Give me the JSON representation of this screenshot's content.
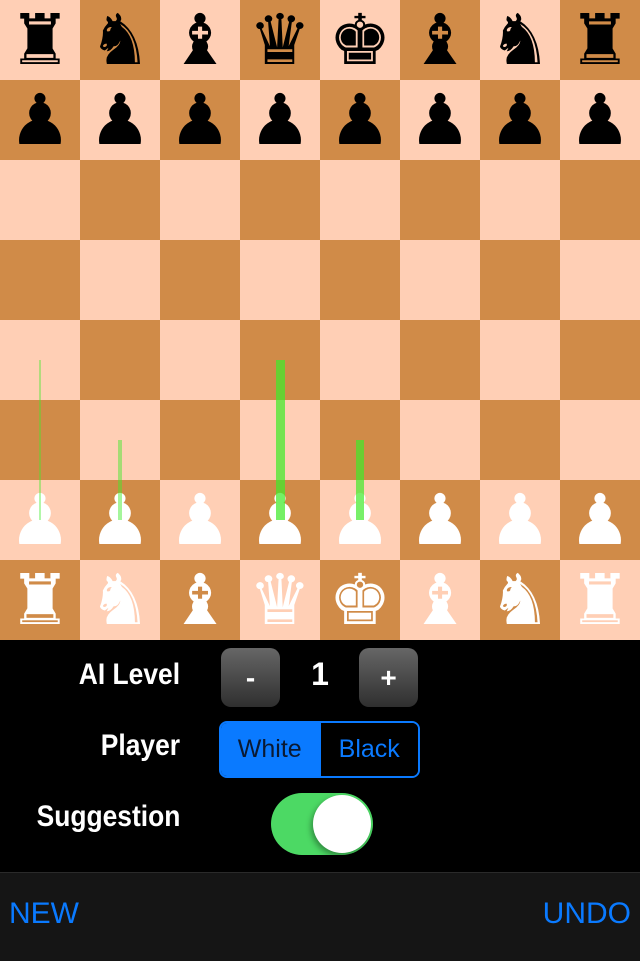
{
  "board": {
    "colors": {
      "light": "#FFCFB5",
      "dark": "#D08B48"
    },
    "pieces": [
      {
        "square": "a8",
        "color": "black",
        "type": "rook",
        "glyph": "♜"
      },
      {
        "square": "b8",
        "color": "black",
        "type": "knight",
        "glyph": "♞"
      },
      {
        "square": "c8",
        "color": "black",
        "type": "bishop",
        "glyph": "♝"
      },
      {
        "square": "d8",
        "color": "black",
        "type": "queen",
        "glyph": "♛"
      },
      {
        "square": "e8",
        "color": "black",
        "type": "king",
        "glyph": "♚"
      },
      {
        "square": "f8",
        "color": "black",
        "type": "bishop",
        "glyph": "♝"
      },
      {
        "square": "g8",
        "color": "black",
        "type": "knight",
        "glyph": "♞"
      },
      {
        "square": "h8",
        "color": "black",
        "type": "rook",
        "glyph": "♜"
      },
      {
        "square": "a7",
        "color": "black",
        "type": "pawn",
        "glyph": "♟"
      },
      {
        "square": "b7",
        "color": "black",
        "type": "pawn",
        "glyph": "♟"
      },
      {
        "square": "c7",
        "color": "black",
        "type": "pawn",
        "glyph": "♟"
      },
      {
        "square": "d7",
        "color": "black",
        "type": "pawn",
        "glyph": "♟"
      },
      {
        "square": "e7",
        "color": "black",
        "type": "pawn",
        "glyph": "♟"
      },
      {
        "square": "f7",
        "color": "black",
        "type": "pawn",
        "glyph": "♟"
      },
      {
        "square": "g7",
        "color": "black",
        "type": "pawn",
        "glyph": "♟"
      },
      {
        "square": "h7",
        "color": "black",
        "type": "pawn",
        "glyph": "♟"
      },
      {
        "square": "a2",
        "color": "white",
        "type": "pawn",
        "glyph": "♟"
      },
      {
        "square": "b2",
        "color": "white",
        "type": "pawn",
        "glyph": "♟"
      },
      {
        "square": "c2",
        "color": "white",
        "type": "pawn",
        "glyph": "♟"
      },
      {
        "square": "d2",
        "color": "white",
        "type": "pawn",
        "glyph": "♟"
      },
      {
        "square": "e2",
        "color": "white",
        "type": "pawn",
        "glyph": "♟"
      },
      {
        "square": "f2",
        "color": "white",
        "type": "pawn",
        "glyph": "♟"
      },
      {
        "square": "g2",
        "color": "white",
        "type": "pawn",
        "glyph": "♟"
      },
      {
        "square": "h2",
        "color": "white",
        "type": "pawn",
        "glyph": "♟"
      },
      {
        "square": "a1",
        "color": "white",
        "type": "rook",
        "glyph": "♜"
      },
      {
        "square": "b1",
        "color": "white",
        "type": "knight",
        "glyph": "♞"
      },
      {
        "square": "c1",
        "color": "white",
        "type": "bishop",
        "glyph": "♝"
      },
      {
        "square": "d1",
        "color": "white",
        "type": "queen",
        "glyph": "♛"
      },
      {
        "square": "e1",
        "color": "white",
        "type": "king",
        "glyph": "♚"
      },
      {
        "square": "f1",
        "color": "white",
        "type": "bishop",
        "glyph": "♝"
      },
      {
        "square": "g1",
        "color": "white",
        "type": "knight",
        "glyph": "♞"
      },
      {
        "square": "h1",
        "color": "white",
        "type": "rook",
        "glyph": "♜"
      }
    ],
    "suggestions": [
      {
        "from": "a2",
        "to": "a4",
        "strength": 0.2
      },
      {
        "from": "b2",
        "to": "b3",
        "strength": 0.35
      },
      {
        "from": "d2",
        "to": "d4",
        "strength": 0.85
      },
      {
        "from": "e2",
        "to": "e3",
        "strength": 0.8
      }
    ],
    "suggestion_color": "#3FEA2A"
  },
  "controls": {
    "ai_level": {
      "label": "AI Level",
      "value": "1",
      "decrement_label": "-",
      "increment_label": "+"
    },
    "player": {
      "label": "Player",
      "options": [
        "White",
        "Black"
      ],
      "selected": "White"
    },
    "suggestion": {
      "label": "Suggestion",
      "enabled": true
    }
  },
  "toolbar": {
    "new_label": "NEW",
    "undo_label": "UNDO"
  },
  "accent": "#0A7AFF",
  "toggle_on_color": "#4CD964"
}
